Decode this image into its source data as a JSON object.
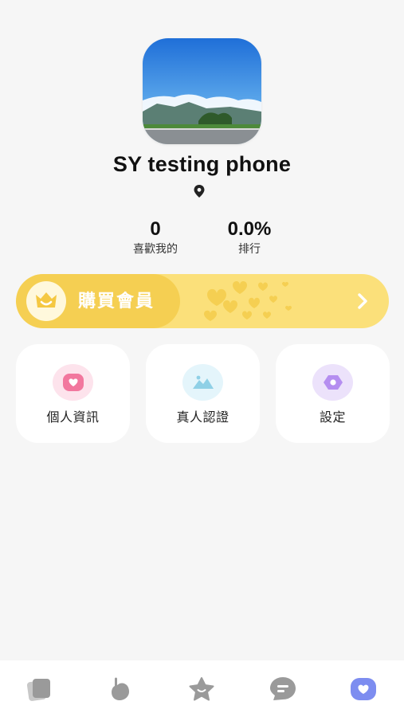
{
  "profile": {
    "name": "SY testing phone",
    "location_icon": "location-pin-icon",
    "stats": [
      {
        "value": "0",
        "label": "喜歡我的"
      },
      {
        "value": "0.0%",
        "label": "排行"
      }
    ]
  },
  "vip": {
    "label": "購買會員",
    "icon": "smile-crown-icon",
    "arrow_icon": "chevron-right-icon",
    "colors": {
      "base": "#fbe07a",
      "left": "#f5cf52"
    }
  },
  "tiles": [
    {
      "label": "個人資訊",
      "icon": "heart-icon",
      "bg": "#fde3ec",
      "color": "#f2779e"
    },
    {
      "label": "真人認證",
      "icon": "mountain-icon",
      "bg": "#e4f5fb",
      "color": "#8fd0e6"
    },
    {
      "label": "設定",
      "icon": "gear-icon",
      "bg": "#ece2fb",
      "color": "#b58ef0"
    }
  ],
  "tabbar": {
    "tabs": [
      {
        "icon": "cards-icon",
        "active": false
      },
      {
        "icon": "gesture-icon",
        "active": false
      },
      {
        "icon": "star-icon",
        "active": false
      },
      {
        "icon": "chat-icon",
        "active": false
      },
      {
        "icon": "heart-profile-icon",
        "active": true
      }
    ],
    "colors": {
      "inactive": "#9a9a9a",
      "active": "#7d8df0"
    }
  }
}
